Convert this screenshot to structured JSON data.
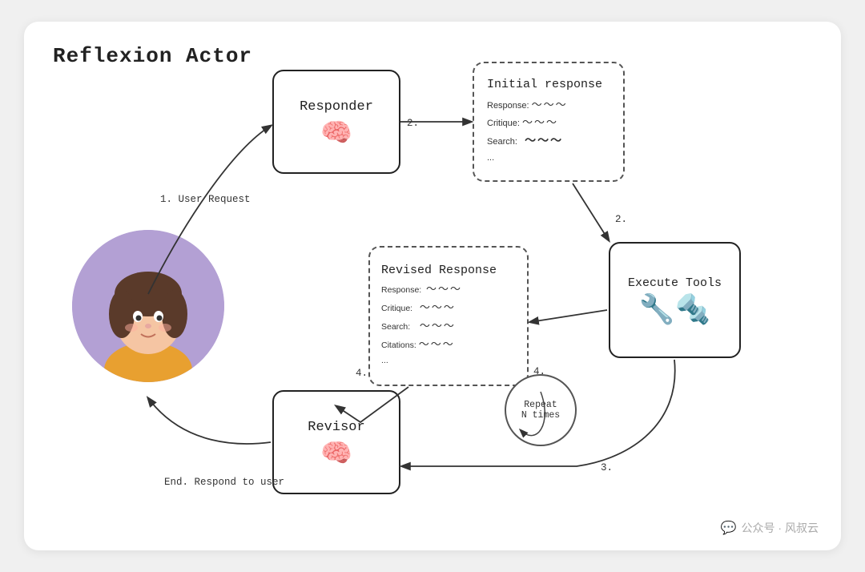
{
  "title": "Reflexion Actor",
  "responder": {
    "label": "Responder",
    "icon": "🧠"
  },
  "initial_response": {
    "label": "Initial response",
    "lines": [
      {
        "key": "Response:",
        "val": "~~~"
      },
      {
        "key": "Critique:",
        "val": "~~~"
      },
      {
        "key": "Search:",
        "val": "~~~"
      },
      {
        "key": "...",
        "val": ""
      }
    ]
  },
  "execute_tools": {
    "label": "Execute Tools",
    "icon": "🔧"
  },
  "revised_response": {
    "label": "Revised Response",
    "lines": [
      {
        "key": "Response:",
        "val": "~~~"
      },
      {
        "key": "Critique:",
        "val": "~~~"
      },
      {
        "key": "Search:",
        "val": "~~~"
      },
      {
        "key": "Citations:",
        "val": "~~~"
      },
      {
        "key": "...",
        "val": ""
      }
    ]
  },
  "revisor": {
    "label": "Revisor",
    "icon": "🧠"
  },
  "repeat": {
    "line1": "Repeat",
    "line2": "N times"
  },
  "arrows": {
    "user_request": "1. User Request",
    "arrow2_top": "2.",
    "arrow2_right": "2.",
    "arrow3": "3.",
    "arrow4_left": "4.",
    "arrow4_right": "4.",
    "end": "End. Respond to user"
  },
  "watermark": "公众号 · 风叔云"
}
